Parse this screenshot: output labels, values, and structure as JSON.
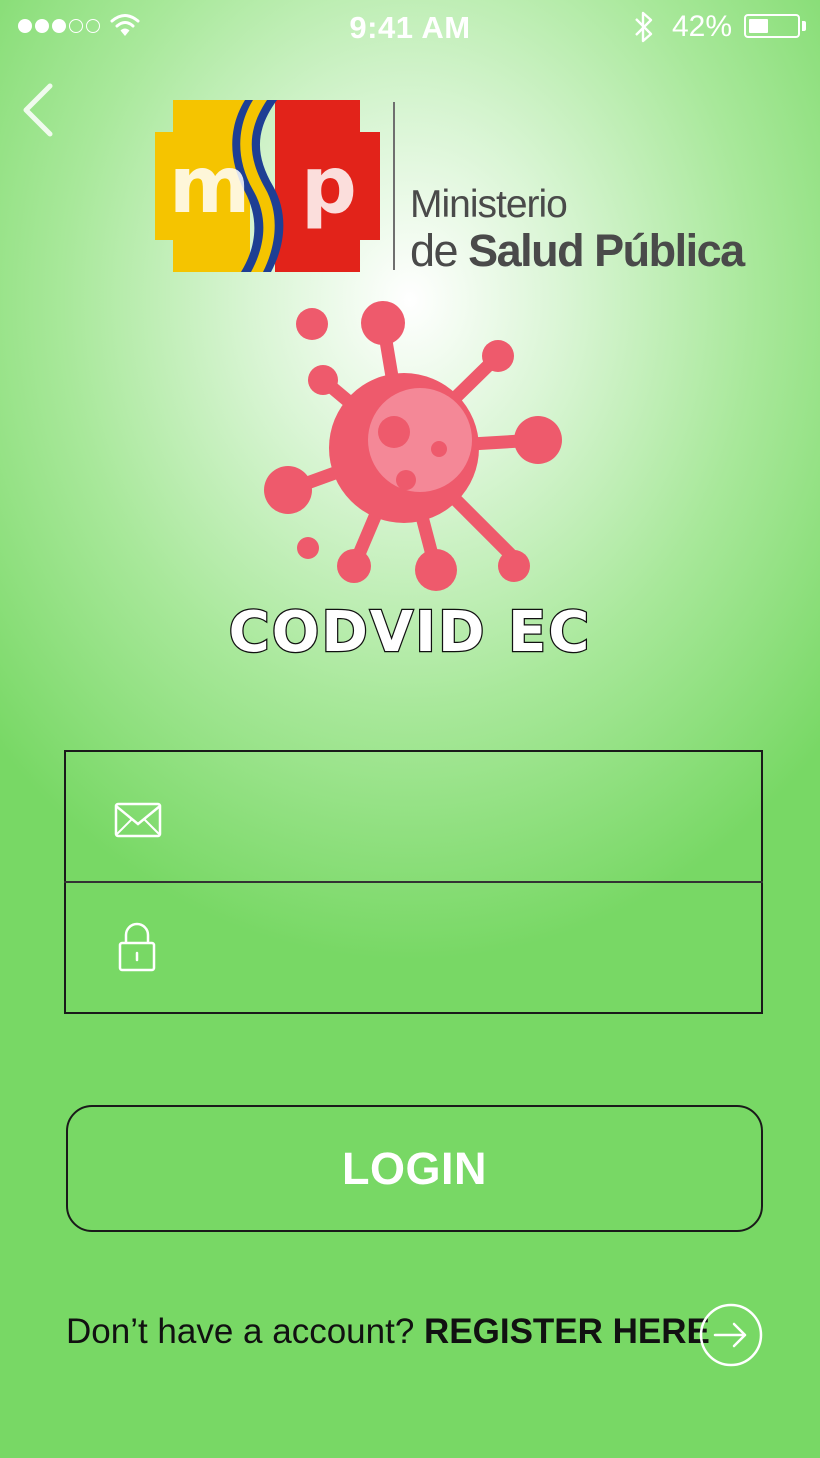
{
  "status_bar": {
    "time": "9:41 AM",
    "battery_percent_label": "42%",
    "battery_level": 0.42,
    "signal_bars_filled": 3,
    "signal_bars_total": 5
  },
  "header": {
    "back_icon": "chevron-left-icon"
  },
  "logo": {
    "letters": "msp",
    "ministry_line1": "Ministerio",
    "ministry_line2_prefix": "de ",
    "ministry_line2_bold": "Salud Pública",
    "colors": {
      "yellow": "#f5c400",
      "blue": "#1e3f94",
      "red": "#e2231a"
    }
  },
  "app": {
    "title": "CODVID EC",
    "virus_color": "#ee5a6c"
  },
  "form": {
    "email": {
      "icon": "mail-icon",
      "value": "",
      "placeholder": ""
    },
    "password": {
      "icon": "lock-icon",
      "value": "",
      "placeholder": ""
    }
  },
  "actions": {
    "login_label": "LOGIN",
    "register_prompt": "Don’t have a account? ",
    "register_link": "REGISTER HERE",
    "register_icon": "arrow-right-circle-icon"
  },
  "colors": {
    "background": "#78d865",
    "text_dark": "#111111",
    "text_light": "#ffffff"
  }
}
